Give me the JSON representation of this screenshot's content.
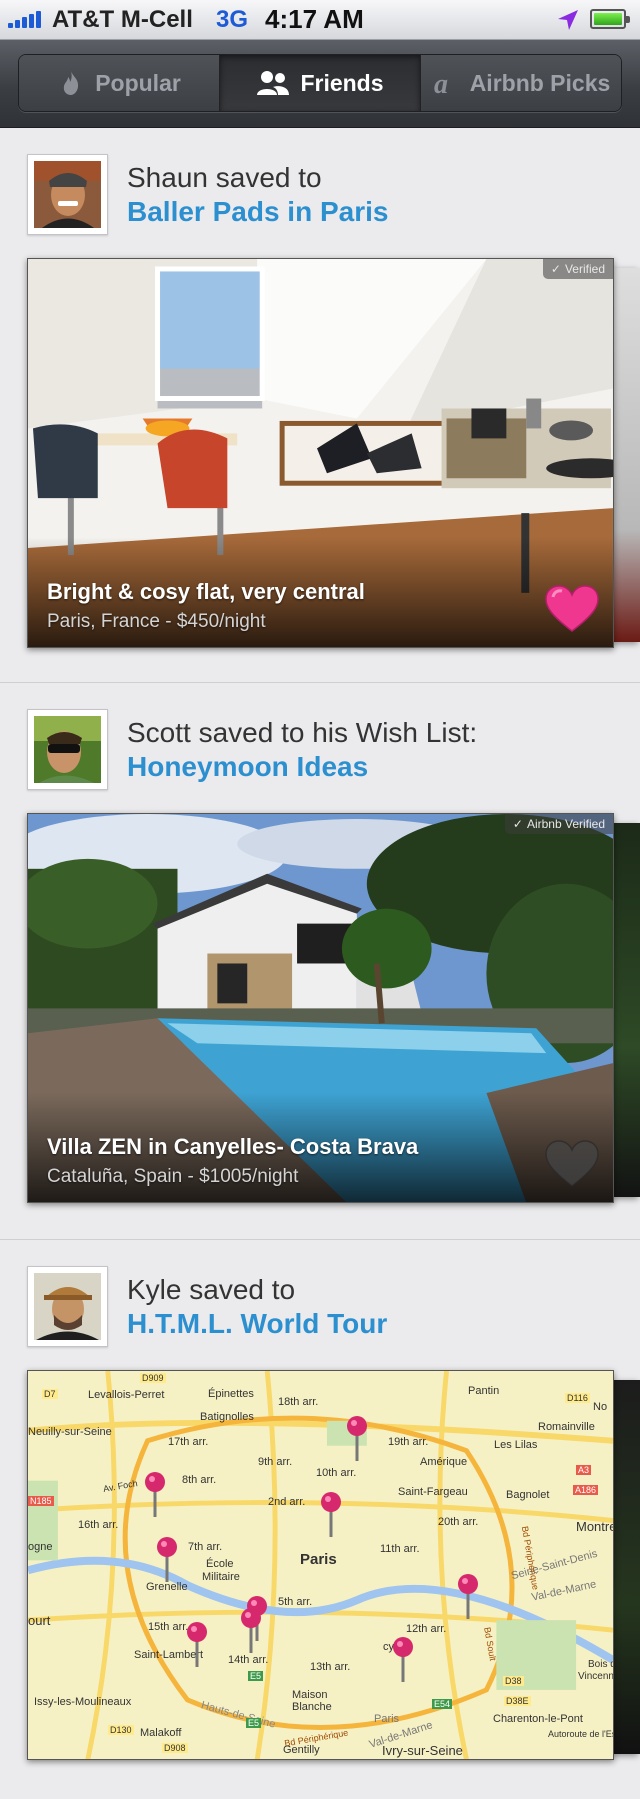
{
  "status_bar": {
    "carrier": "AT&T M-Cell",
    "network": "3G",
    "time": "4:17 AM"
  },
  "tabs": [
    {
      "label": "Popular",
      "icon": "flame-icon",
      "active": false
    },
    {
      "label": "Friends",
      "icon": "people-icon",
      "active": true
    },
    {
      "label": "Airbnb Picks",
      "icon": "airbnb-a-icon",
      "active": false
    }
  ],
  "feed": [
    {
      "actor_line": "Shaun saved to",
      "list_name": "Baller Pads in Paris",
      "card": {
        "badge": "Verified",
        "title": "Bright & cosy flat, very central",
        "subtitle": "Paris, France - $450/night",
        "favorited": true
      }
    },
    {
      "actor_line": "Scott saved to his Wish List:",
      "list_name": "Honeymoon Ideas",
      "card": {
        "badge": "Airbnb Verified",
        "title": "Villa ZEN in Canyelles- Costa Brava",
        "subtitle": "Cataluña, Spain - $1005/night",
        "favorited": false
      }
    },
    {
      "actor_line": "Kyle saved to",
      "list_name": "H.T.M.L. World Tour",
      "map_labels": [
        "D909",
        "Levallois-Perret",
        "Épinettes",
        "Pantin",
        "D116",
        "D7",
        "18th arr.",
        "Batignolles",
        "Neuilly-sur-Seine",
        "No",
        "17th arr.",
        "19th arr.",
        "Romainville",
        "Amérique",
        "Les Lilas",
        "9th arr.",
        "10th arr.",
        "8th arr.",
        "Av. Foch",
        "A3",
        "N185",
        "Saint-Fargeau",
        "Bagnolet",
        "A186",
        "2nd arr.",
        "16th arr.",
        "20th arr.",
        "Montre",
        "ogne",
        "7th arr.",
        "11th arr.",
        "Paris",
        "École",
        "Militaire",
        "Seine-Saint-Denis",
        "Grenelle",
        "Val-de-Marne",
        "5th arr.",
        "ourt",
        "15th arr.",
        "12th arr.",
        "Saint-Lambert",
        "14th arr.",
        "cy",
        "13th arr.",
        "Bois de",
        "Vincennes",
        "D38",
        "Maison",
        "Blanche",
        "Issy-les-Moulineaux",
        "Hauts-de-Seine",
        "D38E",
        "E54",
        "Paris",
        "E5",
        "Charenton-le-Pont",
        "Val-de-Marne",
        "D130",
        "Malakoff",
        "Autoroute de l'Est",
        "Bd Périphérique",
        "Bd Périphérique",
        "Bd Soult",
        "D908",
        "Gentilly",
        "Ivry-sur-Seine",
        "E5"
      ]
    }
  ]
}
